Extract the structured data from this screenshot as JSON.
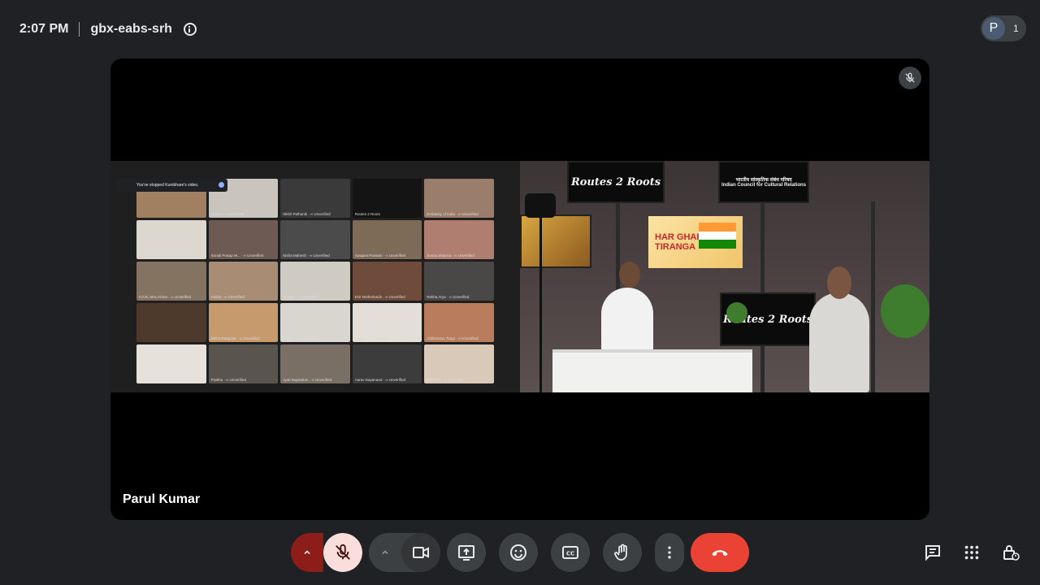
{
  "header": {
    "time": "2:07 PM",
    "meeting_code": "gbx-eabs-srh",
    "info_icon": "info-icon",
    "participants_initial": "P",
    "participants_count": "1"
  },
  "stage": {
    "presenter_name": "Parul Kumar",
    "mute_indicator_icon": "mic-off-icon"
  },
  "shared_screen": {
    "toast_text": "You've stopped Kumbhare's video.",
    "tiles": [
      {
        "label": "",
        "color": "#a08060"
      },
      {
        "label": "Aviral · ∞ Unverified",
        "color": "#c9c5be"
      },
      {
        "label": "Nikhil Pathanik · ∞ Unverified",
        "color": "#3a3a3a"
      },
      {
        "label": "Routes 2 Roots",
        "color": "#141414"
      },
      {
        "label": "Embassy of India · ∞ Unverified",
        "color": "#9a7d6b"
      },
      {
        "label": "",
        "color": "#dcd7cf"
      },
      {
        "label": "Sonali Pratap W... · ∞ Unverified",
        "color": "#6d5a52"
      },
      {
        "label": "Nisha Mahesh · ∞ Unverified",
        "color": "#4b4b4b"
      },
      {
        "label": "Swapna Paswan · ∞ Unverified",
        "color": "#7d6a57"
      },
      {
        "label": "Sunita Sharma · ∞ Unverified",
        "color": "#b07e70"
      },
      {
        "label": "ICCR, MALAYSIA · ∞ Unverified",
        "color": "#857362"
      },
      {
        "label": "Ankita · ∞ Unverified",
        "color": "#a88d74"
      },
      {
        "label": "Srutika · ∞ Unverified",
        "color": "#cfcac2"
      },
      {
        "label": "EOI Netherlands · ∞ Unverified",
        "color": "#6e4b3b"
      },
      {
        "label": "Rekha Arya · ∞ Unverified",
        "color": "#4a4847"
      },
      {
        "label": "",
        "color": "#4e3a2c"
      },
      {
        "label": "Nisha Rangotar · ∞ Unverified",
        "color": "#c79a6d"
      },
      {
        "label": "Swasti · ∞ Unverified",
        "color": "#d9d6d0"
      },
      {
        "label": "Sangita · ∞ Unverified",
        "color": "#e3ded7"
      },
      {
        "label": "Abhimanyu Tyagi · ∞ Unverified",
        "color": "#b97d5e"
      },
      {
        "label": "",
        "color": "#e6e2db"
      },
      {
        "label": "Prabhu · ∞ Unverified",
        "color": "#5a544f"
      },
      {
        "label": "Jyoti Rajendran · ∞ Unverified",
        "color": "#7a6f65"
      },
      {
        "label": "Aarav Dayanand · ∞ Unverified",
        "color": "#3c3c3c"
      },
      {
        "label": "Manasvi · ∞ Unverified",
        "color": "#d8c9b8"
      }
    ]
  },
  "studio": {
    "monitor_left": "Routes 2 Roots",
    "monitor_right_hindi": "भारतीय सांस्कृतिक संबंध परिषद",
    "monitor_right_english": "Indian Council for Cultural Relations",
    "monitor_center": "Routes 2 Roots",
    "banner_line1": "HAR GHAR",
    "banner_line2": "TIRANGA"
  },
  "controls": {
    "mic_caret": "chevron-up-icon",
    "mic": "mic-off-icon",
    "cam_caret": "chevron-up-icon",
    "camera": "videocam-icon",
    "present": "present-to-all-icon",
    "reactions": "emoji-icon",
    "captions": "closed-caption-icon",
    "raise_hand": "hand-icon",
    "more": "more-vert-icon",
    "leave": "call-end-icon",
    "chat": "chat-icon",
    "activities": "apps-icon",
    "host_controls": "lock-person-icon"
  },
  "colors": {
    "background": "#202124",
    "surface": "#3c4043",
    "danger": "#ea4335",
    "mic_muted_bg": "#f9dedc",
    "mic_muted_caret": "#8c1d18"
  }
}
